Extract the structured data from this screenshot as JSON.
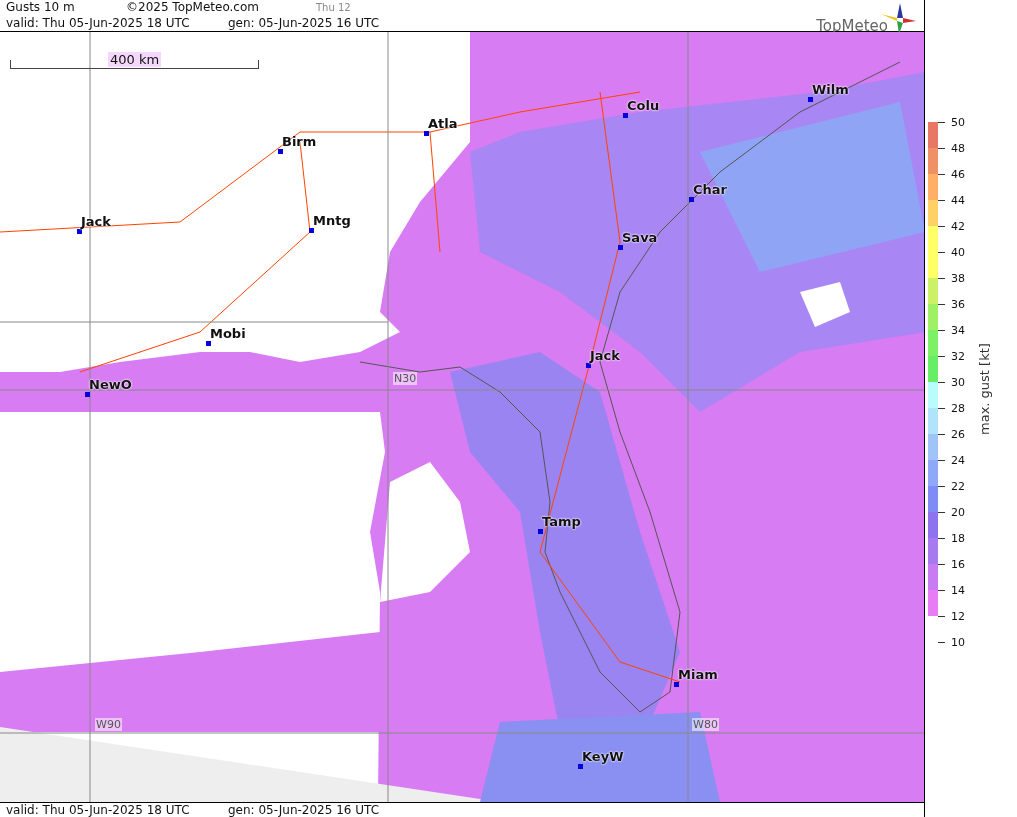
{
  "header": {
    "title": "Gusts 10 m",
    "copyright": "©2025 TopMeteo.com",
    "run_label": "Thu 12",
    "valid": "valid:  Thu  05-Jun-2025  18 UTC",
    "generated": "gen: 05-Jun-2025 16 UTC"
  },
  "logo": {
    "text": "TopMeteo"
  },
  "map": {
    "scale_label": "400 km",
    "cities": [
      {
        "name": "Wilm"
      },
      {
        "name": "Colu"
      },
      {
        "name": "Atla"
      },
      {
        "name": "Birm"
      },
      {
        "name": "Char"
      },
      {
        "name": "Mntg"
      },
      {
        "name": "Jack"
      },
      {
        "name": "Sava"
      },
      {
        "name": "Mobi"
      },
      {
        "name": "Jack"
      },
      {
        "name": "NewO"
      },
      {
        "name": "Tamp"
      },
      {
        "name": "Miam"
      },
      {
        "name": "KeyW"
      }
    ],
    "grid_labels": [
      "N30",
      "W90",
      "W80"
    ]
  },
  "legend": {
    "axis_label": "max. gust [kt]",
    "ticks": [
      "50",
      "48",
      "46",
      "44",
      "42",
      "40",
      "38",
      "36",
      "34",
      "32",
      "30",
      "28",
      "26",
      "24",
      "22",
      "20",
      "18",
      "16",
      "14",
      "12",
      "10"
    ],
    "bands": [
      {
        "color": "#e87866"
      },
      {
        "color": "#f09066"
      },
      {
        "color": "#ffb066"
      },
      {
        "color": "#ffd066"
      },
      {
        "color": "#ffff66"
      },
      {
        "color": "#ffff66"
      },
      {
        "color": "#ccf066"
      },
      {
        "color": "#a0f066"
      },
      {
        "color": "#7cf066"
      },
      {
        "color": "#66ee66"
      },
      {
        "color": "#b8fcfc"
      },
      {
        "color": "#b0e4fa"
      },
      {
        "color": "#a0c4f8"
      },
      {
        "color": "#8fa8f8"
      },
      {
        "color": "#7f8cf5"
      },
      {
        "color": "#8f72ee"
      },
      {
        "color": "#a87af0"
      },
      {
        "color": "#c87cf2"
      },
      {
        "color": "#e87cf5"
      }
    ]
  },
  "footer": {
    "valid": "valid:  Thu  05-Jun-2025  18 UTC",
    "generated": "gen: 05-Jun-2025 16 UTC"
  }
}
